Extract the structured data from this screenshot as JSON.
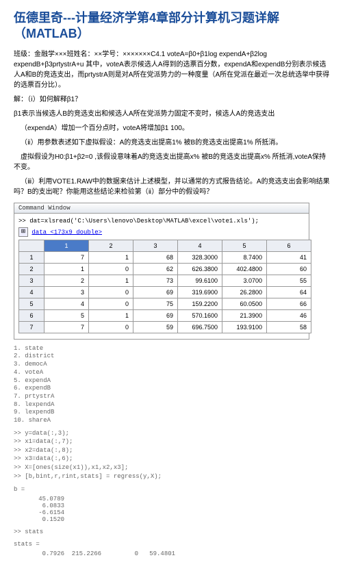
{
  "title": "伍德里奇---计量经济学第4章部分计算机习题详解（MATLAB）",
  "p1": "班级：金融学×××班姓名：××学号：×××××××C4.1 voteA=β0+β1log expendA+β2log expendB+β3prtystrA+u 其中，voteA表示候选人A得到的选票百分数，expendA和expendB分别表示候选人A和B的竞选支出，而prtystrA则是对A所在党派势力的一种度量（A所在党派在最近一次总统选举中获得的选票百分比）。",
  "p2": "解：（ⅰ）如何解释β1？",
  "p3": "β1表示当候选人B的竞选支出和候选人A所在党派势力固定不变时，候选人A的竞选支出",
  "p4": "（expendA）增加一个百分点时，voteA将增加β1 100。",
  "p5": "（ⅱ）用参数表述如下虚拟假设：A的竞选支出提高1% 被B的竞选支出提高1% 所抵消。",
  "p6": "虚拟假设为H0:β1+β2=0 ,该假设意味着A的竞选支出提高x% 被B的竞选支出提高x% 所抵消,voteA保持不变。",
  "p7": "（ⅲ）利用VOTE1.RAW中的数据来估计上述模型，并以通常的方式报告结论。A的竞选支出会影响结果吗？B的支出呢？你能用这些结论来检验第（ⅱ）部分中的假设吗？",
  "cw_title": "Command Window",
  "cw_cmd": ">> dat=xlsread('C:\\Users\\lenovo\\Desktop\\MATLAB\\excel\\vote1.xls');",
  "dt_label": "data <173x9 double>",
  "sheet": {
    "cols": [
      "",
      "1",
      "2",
      "3",
      "4",
      "5",
      "6"
    ],
    "rows": [
      [
        "1",
        "7",
        "1",
        "68",
        "328.3000",
        "8.7400",
        "41"
      ],
      [
        "2",
        "1",
        "0",
        "62",
        "626.3800",
        "402.4800",
        "60"
      ],
      [
        "3",
        "2",
        "1",
        "73",
        "99.6100",
        "3.0700",
        "55"
      ],
      [
        "4",
        "3",
        "0",
        "69",
        "319.6900",
        "26.2800",
        "64"
      ],
      [
        "5",
        "4",
        "0",
        "75",
        "159.2200",
        "60.0500",
        "66"
      ],
      [
        "6",
        "5",
        "1",
        "69",
        "570.1600",
        "21.3900",
        "46"
      ],
      [
        "7",
        "7",
        "0",
        "59",
        "696.7500",
        "193.9100",
        "58"
      ]
    ]
  },
  "vars": [
    "1. state",
    "2. district",
    "3. democA",
    "4. voteA",
    "5. expendA",
    "6. expendB",
    "7. prtystrA",
    "8. lexpendA",
    "9. lexpendB",
    "10. shareA"
  ],
  "cmds": [
    ">> y=data(:,3);",
    ">> x1=data(:,7);",
    ">> x2=data(:,8);",
    ">> x3=data(:,6);",
    ">> X=[ones(size(x1)),x1,x2,x3];",
    ">> [b,bint,r,rint,stats] = regress(y,X);"
  ],
  "b_label": "b =",
  "b_vals": "   45.0789\n    6.0833\n   -6.6154\n    0.1520",
  "stats_prompt": ">> stats",
  "stats_label": "stats =",
  "stats_vals": "    0.7926  215.2266         0   59.4801"
}
